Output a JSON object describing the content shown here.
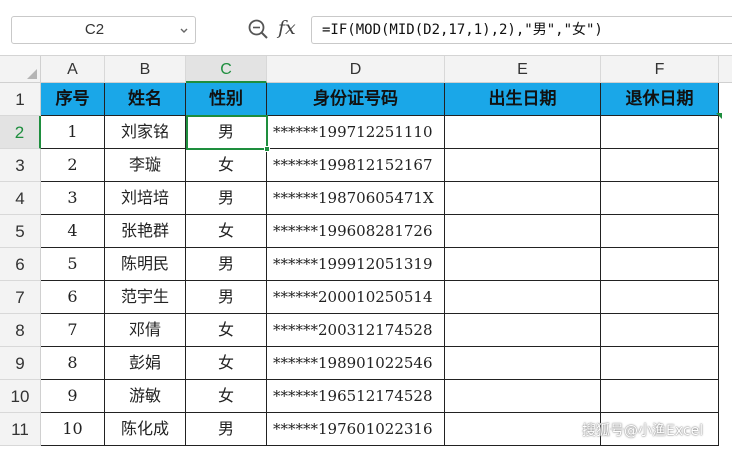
{
  "formula_bar": {
    "name_box": "C2",
    "formula": "=IF(MOD(MID(D2,17,1),2),\"男\",\"女\")",
    "zoom_icon": "magnifier-icon",
    "fx_label": "fx"
  },
  "grid": {
    "columns": [
      "A",
      "B",
      "C",
      "D",
      "E",
      "F"
    ],
    "active_column": "C",
    "active_row": "2",
    "headers": [
      "序号",
      "姓名",
      "性别",
      "身份证号码",
      "出生日期",
      "退休日期"
    ],
    "rows": [
      {
        "row": "2",
        "no": "1",
        "name": "刘家铭",
        "gender": "男",
        "id": "******199712251110",
        "birth": "",
        "retire": ""
      },
      {
        "row": "3",
        "no": "2",
        "name": "李璇",
        "gender": "女",
        "id": "******199812152167",
        "birth": "",
        "retire": ""
      },
      {
        "row": "4",
        "no": "3",
        "name": "刘培培",
        "gender": "男",
        "id": "******19870605471X",
        "birth": "",
        "retire": ""
      },
      {
        "row": "5",
        "no": "4",
        "name": "张艳群",
        "gender": "女",
        "id": "******199608281726",
        "birth": "",
        "retire": ""
      },
      {
        "row": "6",
        "no": "5",
        "name": "陈明民",
        "gender": "男",
        "id": "******199912051319",
        "birth": "",
        "retire": ""
      },
      {
        "row": "7",
        "no": "6",
        "name": "范宇生",
        "gender": "男",
        "id": "******200010250514",
        "birth": "",
        "retire": ""
      },
      {
        "row": "8",
        "no": "7",
        "name": "邓倩",
        "gender": "女",
        "id": "******200312174528",
        "birth": "",
        "retire": ""
      },
      {
        "row": "9",
        "no": "8",
        "name": "彭娟",
        "gender": "女",
        "id": "******198901022546",
        "birth": "",
        "retire": ""
      },
      {
        "row": "10",
        "no": "9",
        "name": "游敏",
        "gender": "女",
        "id": "******196512174528",
        "birth": "",
        "retire": ""
      },
      {
        "row": "11",
        "no": "10",
        "name": "陈化成",
        "gender": "男",
        "id": "******197601022316",
        "birth": "",
        "retire": ""
      }
    ],
    "header_row_label": "1"
  },
  "watermark": "搜狐号@小渔Excel",
  "colors": {
    "header_fill": "#1aa7e8",
    "selection": "#1e8e3e"
  }
}
